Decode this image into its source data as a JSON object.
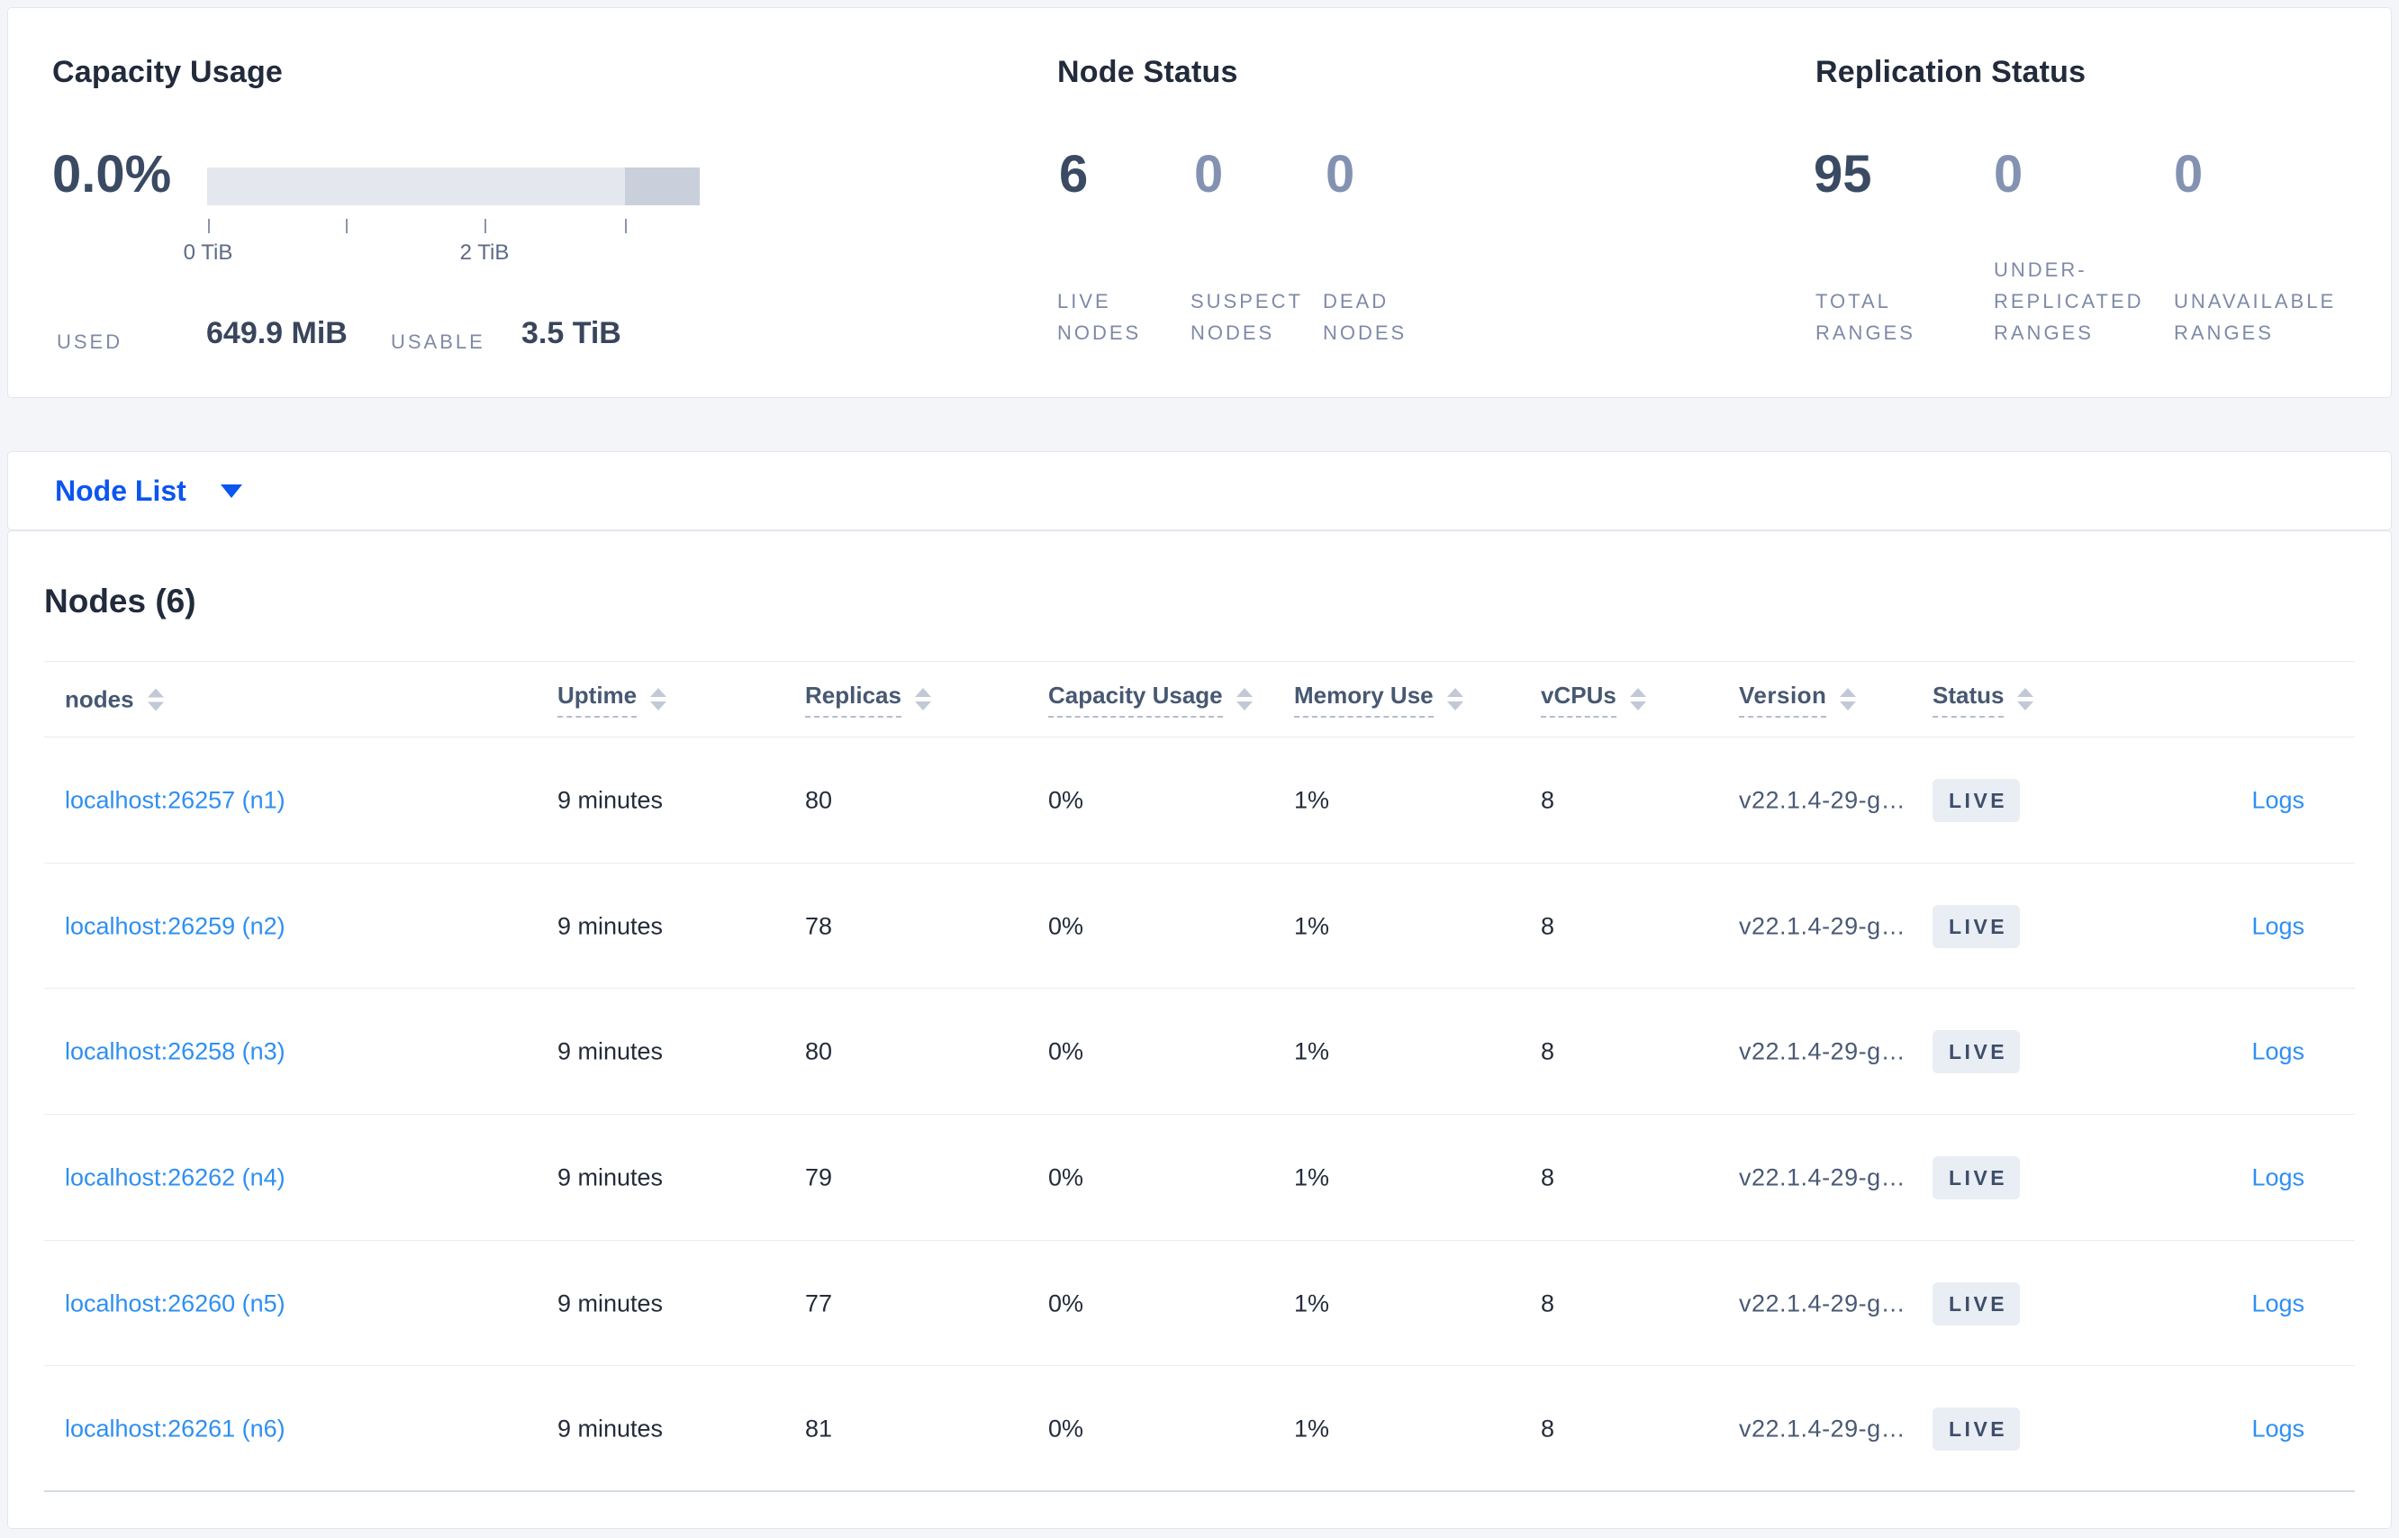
{
  "summary": {
    "capacity": {
      "title": "Capacity Usage",
      "percent": "0.0%",
      "tick_labels": [
        "0 TiB",
        "2 TiB"
      ],
      "used_label": "USED",
      "used_value": "649.9 MiB",
      "usable_label": "USABLE",
      "usable_value": "3.5 TiB"
    },
    "node_status": {
      "title": "Node Status",
      "stats": [
        {
          "value": "6",
          "label": "LIVE NODES"
        },
        {
          "value": "0",
          "label": "SUSPECT NODES"
        },
        {
          "value": "0",
          "label": "DEAD NODES"
        }
      ]
    },
    "replication_status": {
      "title": "Replication Status",
      "stats": [
        {
          "value": "95",
          "label": "TOTAL RANGES"
        },
        {
          "value": "0",
          "label": "UNDER-REPLICATED RANGES"
        },
        {
          "value": "0",
          "label": "UNAVAILABLE RANGES"
        }
      ]
    }
  },
  "view_selector": {
    "label": "Node List",
    "caret_icon": "triangle-down-icon"
  },
  "nodes_table": {
    "title": "Nodes (6)",
    "columns": [
      {
        "label": "nodes"
      },
      {
        "label": "Uptime"
      },
      {
        "label": "Replicas"
      },
      {
        "label": "Capacity Usage"
      },
      {
        "label": "Memory Use"
      },
      {
        "label": "vCPUs"
      },
      {
        "label": "Version"
      },
      {
        "label": "Status"
      }
    ],
    "logs_label": "Logs",
    "rows": [
      {
        "node": "localhost:26257 (n1)",
        "uptime": "9 minutes",
        "replicas": "80",
        "capacity": "0%",
        "memory": "1%",
        "vcpus": "8",
        "version": "v22.1.4-29-g…",
        "status": "LIVE"
      },
      {
        "node": "localhost:26259 (n2)",
        "uptime": "9 minutes",
        "replicas": "78",
        "capacity": "0%",
        "memory": "1%",
        "vcpus": "8",
        "version": "v22.1.4-29-g…",
        "status": "LIVE"
      },
      {
        "node": "localhost:26258 (n3)",
        "uptime": "9 minutes",
        "replicas": "80",
        "capacity": "0%",
        "memory": "1%",
        "vcpus": "8",
        "version": "v22.1.4-29-g…",
        "status": "LIVE"
      },
      {
        "node": "localhost:26262 (n4)",
        "uptime": "9 minutes",
        "replicas": "79",
        "capacity": "0%",
        "memory": "1%",
        "vcpus": "8",
        "version": "v22.1.4-29-g…",
        "status": "LIVE"
      },
      {
        "node": "localhost:26260 (n5)",
        "uptime": "9 minutes",
        "replicas": "77",
        "capacity": "0%",
        "memory": "1%",
        "vcpus": "8",
        "version": "v22.1.4-29-g…",
        "status": "LIVE"
      },
      {
        "node": "localhost:26261 (n6)",
        "uptime": "9 minutes",
        "replicas": "81",
        "capacity": "0%",
        "memory": "1%",
        "vcpus": "8",
        "version": "v22.1.4-29-g…",
        "status": "LIVE"
      }
    ]
  },
  "colors": {
    "page_background": "#f3f5f9",
    "accent_blue": "#0b55f0",
    "link_blue": "#2e8ff2",
    "stat_dark": "#3b4a63",
    "stat_muted": "#8492b2",
    "label_muted": "#7e8aa6",
    "capacity_bar_light": "#e4e7ee",
    "capacity_bar_dark": "#c9cfdb",
    "badge_background": "#e9edf4",
    "badge_text": "#3e4e6a"
  }
}
